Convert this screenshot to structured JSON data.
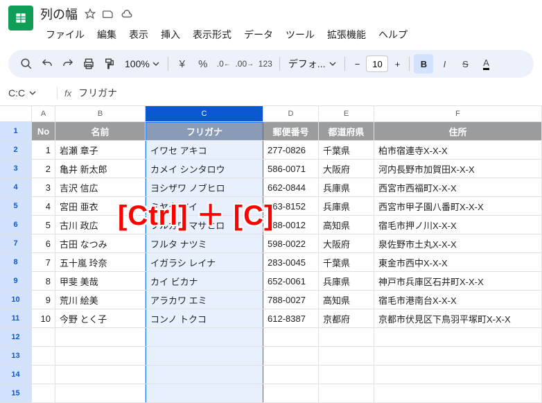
{
  "doc": {
    "title": "列の幅"
  },
  "menu": [
    "ファイル",
    "編集",
    "表示",
    "挿入",
    "表示形式",
    "データ",
    "ツール",
    "拡張機能",
    "ヘルプ"
  ],
  "toolbar": {
    "zoom": "100%",
    "currency": "¥",
    "font": "デフォ...",
    "font_size": "10"
  },
  "name_box": "C:C",
  "formula": "フリガナ",
  "columns": [
    "A",
    "B",
    "C",
    "D",
    "E",
    "F"
  ],
  "header_row": [
    "No",
    "名前",
    "フリガナ",
    "郵便番号",
    "都道府県",
    "住所"
  ],
  "rows": [
    [
      "1",
      "岩瀬 章子",
      "イワセ アキコ",
      "277-0826",
      "千葉県",
      "柏市宿連寺X-X-X"
    ],
    [
      "2",
      "亀井 新太郎",
      "カメイ シンタロウ",
      "586-0071",
      "大阪府",
      "河内長野市加賀田X-X-X"
    ],
    [
      "3",
      "吉沢 信広",
      "ヨシザワ ノブヒロ",
      "662-0844",
      "兵庫県",
      "西宮市西福町X-X-X"
    ],
    [
      "4",
      "宮田 亜衣",
      "ミヤタ アイ",
      "663-8152",
      "兵庫県",
      "西宮市甲子園八番町X-X-X"
    ],
    [
      "5",
      "古川 政広",
      "フルカワ マサヒロ",
      "788-0012",
      "高知県",
      "宿毛市押ノ川X-X-X"
    ],
    [
      "6",
      "古田 なつみ",
      "フルタ ナツミ",
      "598-0022",
      "大阪府",
      "泉佐野市土丸X-X-X"
    ],
    [
      "7",
      "五十嵐 玲奈",
      "イガラシ レイナ",
      "283-0045",
      "千葉県",
      "東金市西中X-X-X"
    ],
    [
      "8",
      "甲斐 美哉",
      "カイ ビカナ",
      "652-0061",
      "兵庫県",
      "神戸市兵庫区石井町X-X-X"
    ],
    [
      "9",
      "荒川 絵美",
      "アラカワ エミ",
      "788-0027",
      "高知県",
      "宿毛市港南台X-X-X"
    ],
    [
      "10",
      "今野 とく子",
      "コンノ トクコ",
      "612-8387",
      "京都府",
      "京都市伏見区下鳥羽平塚町X-X-X"
    ]
  ],
  "empty_rows": [
    "12",
    "13",
    "14",
    "15"
  ],
  "keyhint": "[Ctrl] ＋ [C]"
}
